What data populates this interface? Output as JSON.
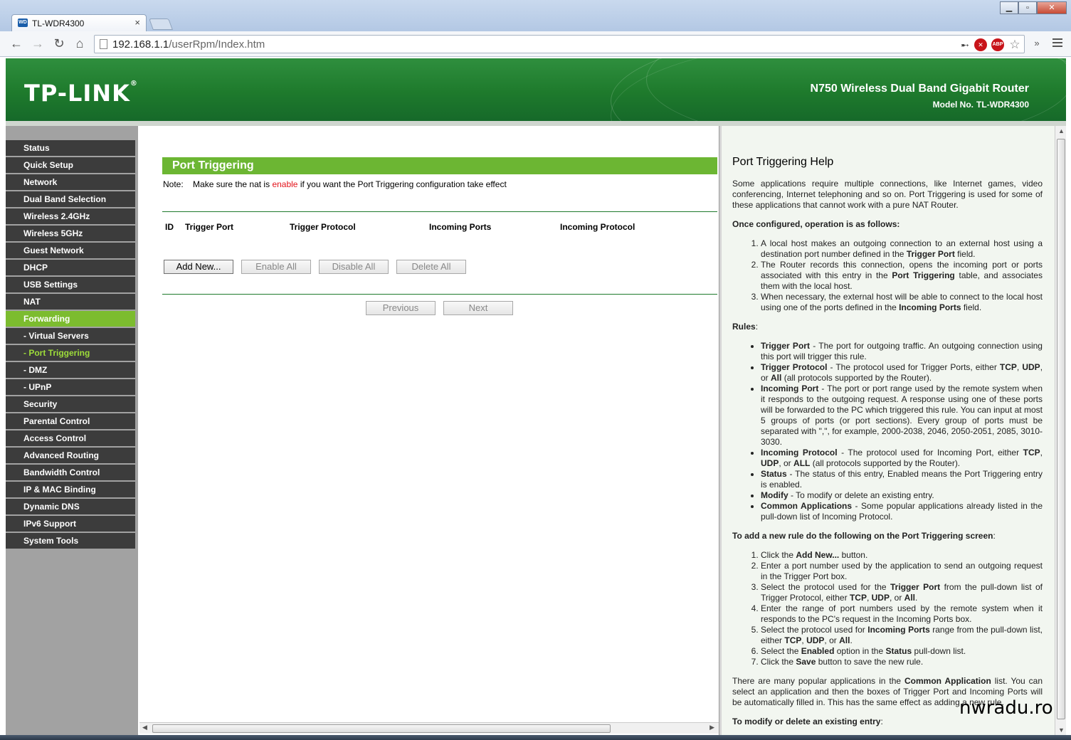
{
  "browser": {
    "tab_title": "TL-WDR4300",
    "favicon_text": "WD",
    "url_host": "192.168.1.1",
    "url_path": "/userRpm/Index.htm",
    "ext_abp": "ABP"
  },
  "header": {
    "logo": "TP-LINK",
    "logo_reg": "®",
    "product": "N750 Wireless Dual Band Gigabit Router",
    "model_label": "Model No.",
    "model_value": "TL-WDR4300"
  },
  "sidebar": {
    "items": [
      {
        "label": "Status"
      },
      {
        "label": "Quick Setup"
      },
      {
        "label": "Network"
      },
      {
        "label": "Dual Band Selection"
      },
      {
        "label": "Wireless 2.4GHz"
      },
      {
        "label": "Wireless 5GHz"
      },
      {
        "label": "Guest Network"
      },
      {
        "label": "DHCP"
      },
      {
        "label": "USB Settings"
      },
      {
        "label": "NAT"
      },
      {
        "label": "Forwarding"
      },
      {
        "label": "- Virtual Servers"
      },
      {
        "label": "- Port Triggering"
      },
      {
        "label": "- DMZ"
      },
      {
        "label": "- UPnP"
      },
      {
        "label": "Security"
      },
      {
        "label": "Parental Control"
      },
      {
        "label": "Access Control"
      },
      {
        "label": "Advanced Routing"
      },
      {
        "label": "Bandwidth Control"
      },
      {
        "label": "IP & MAC Binding"
      },
      {
        "label": "Dynamic DNS"
      },
      {
        "label": "IPv6 Support"
      },
      {
        "label": "System Tools"
      }
    ]
  },
  "main": {
    "title": "Port Triggering",
    "note_label": "Note:",
    "note_pre": "Make sure the nat is",
    "note_highlight": "enable",
    "note_post": "if you want the Port Triggering configuration take effect",
    "columns": [
      "ID",
      "Trigger Port",
      "Trigger Protocol",
      "Incoming Ports",
      "Incoming Protocol"
    ],
    "buttons": {
      "add_new": "Add New...",
      "enable_all": "Enable All",
      "disable_all": "Disable All",
      "delete_all": "Delete All",
      "previous": "Previous",
      "next": "Next"
    }
  },
  "help": {
    "title": "Port Triggering Help",
    "intro": "Some applications require multiple connections, like Internet games, video conferencing, Internet telephoning and so on. Port Triggering is used for some of these applications that cannot work with a pure NAT Router.",
    "operation_heading": "Once configured, operation is as follows:",
    "operation_1a": "A local host makes an outgoing connection to an external host using a destination port number defined in the",
    "operation_1b": "Trigger Port",
    "operation_1c": "field.",
    "operation_2a": "The Router records this connection, opens the incoming port or ports associated with this entry in the",
    "operation_2b": "Port Triggering",
    "operation_2c": "table, and associates them with the local host.",
    "operation_3a": "When necessary, the external host will be able to connect to the local host using one of the ports defined in the",
    "operation_3b": "Incoming Ports",
    "operation_3c": "field.",
    "rules_heading": "Rules",
    "rules_colon": ":",
    "rule_1a": "Trigger Port",
    "rule_1b": "- The port for outgoing traffic. An outgoing connection using this port will trigger this rule.",
    "rule_2a": "Trigger Protocol",
    "rule_2b": "- The protocol used for Trigger Ports, either",
    "rule_2c": "TCP",
    "rule_2d": ",",
    "rule_2e": "UDP",
    "rule_2f": ", or",
    "rule_2g": "All",
    "rule_2h": "(all protocols supported by the Router).",
    "rule_3a": "Incoming Port",
    "rule_3b": "- The port or port range used by the remote system when it responds to the outgoing request. A response using one of these ports will be forwarded to the PC which triggered this rule. You can input at most 5 groups of ports (or port sections). Every group of ports must be separated with \",\", for example, 2000-2038, 2046, 2050-2051, 2085, 3010-3030.",
    "rule_4a": "Incoming Protocol",
    "rule_4b": "- The protocol used for Incoming Port, either",
    "rule_4c": "TCP",
    "rule_4d": ",",
    "rule_4e": "UDP",
    "rule_4f": ", or",
    "rule_4g": "ALL",
    "rule_4h": "(all protocols supported by the Router).",
    "rule_5a": "Status",
    "rule_5b": "- The status of this entry, Enabled means the Port Triggering entry is enabled.",
    "rule_6a": "Modify",
    "rule_6b": "- To modify or delete an existing entry.",
    "rule_7a": "Common Applications",
    "rule_7b": "- Some popular applications already listed in the pull-down list of Incoming Protocol.",
    "add_heading": "To add a new rule do the following on the Port Triggering screen",
    "add_colon": ":",
    "add_1a": "Click the",
    "add_1b": "Add New...",
    "add_1c": "button.",
    "add_2": "Enter a port number used by the application to send an outgoing request in the Trigger Port box.",
    "add_3a": "Select the protocol used for the",
    "add_3b": "Trigger Port",
    "add_3c": "from the pull-down list of Trigger Protocol, either",
    "add_3d": "TCP",
    "add_3e": ",",
    "add_3f": "UDP",
    "add_3g": ", or",
    "add_3h": "All",
    "add_3i": ".",
    "add_4": "Enter the range of port numbers used by the remote system when it responds to the PC's request in the Incoming Ports box.",
    "add_5a": "Select the protocol used for",
    "add_5b": "Incoming Ports",
    "add_5c": "range from the pull-down list, either",
    "add_5d": "TCP",
    "add_5e": ",",
    "add_5f": "UDP",
    "add_5g": ", or",
    "add_5h": "All",
    "add_5i": ".",
    "add_6a": "Select the",
    "add_6b": "Enabled",
    "add_6c": "option in the",
    "add_6d": "Status",
    "add_6e": "pull-down list.",
    "add_7a": "Click the",
    "add_7b": "Save",
    "add_7c": "button to save the new rule.",
    "common_a": "There are many popular applications in the",
    "common_b": "Common Application",
    "common_c": "list. You can select an application and then the boxes of Trigger Port and Incoming Ports will be automatically filled in. This has the same effect as adding a new rule.",
    "modify_heading": "To modify or delete an existing entry",
    "modify_colon": ":"
  },
  "watermark": "nwradu.ro",
  "colors": {
    "brand_green": "#1e7a2c",
    "title_green": "#6cb633",
    "active_green": "#7cbc2f",
    "note_red": "#e3131b",
    "nav_dark": "#3c3c3c"
  }
}
